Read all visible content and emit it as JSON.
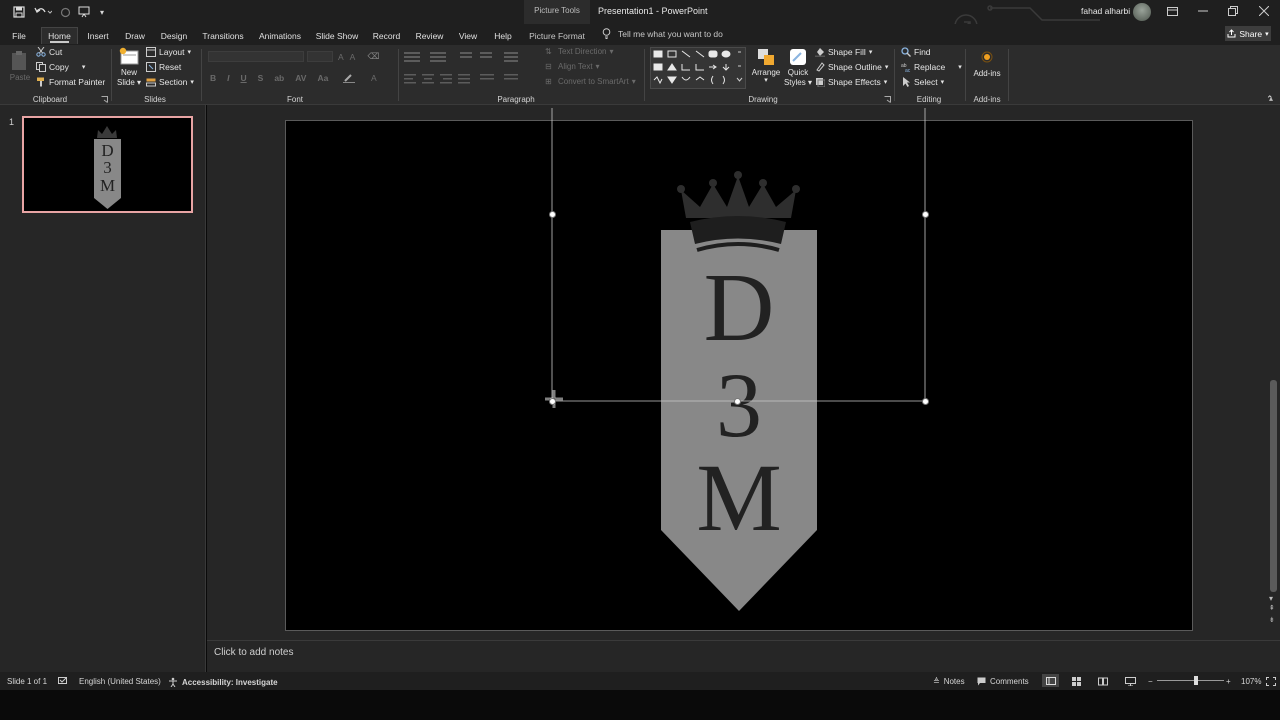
{
  "titlebar": {
    "tools_label": "Picture Tools",
    "doc_title": "Presentation1  -  PowerPoint",
    "user_name": "fahad alharbi"
  },
  "tabs": [
    {
      "label": "File"
    },
    {
      "label": "Home"
    },
    {
      "label": "Insert"
    },
    {
      "label": "Draw"
    },
    {
      "label": "Design"
    },
    {
      "label": "Transitions"
    },
    {
      "label": "Animations"
    },
    {
      "label": "Slide Show"
    },
    {
      "label": "Record"
    },
    {
      "label": "Review"
    },
    {
      "label": "View"
    },
    {
      "label": "Help"
    },
    {
      "label": "Picture Format"
    }
  ],
  "active_tab": "Home",
  "tell_me": "Tell me what you want to do",
  "share": "Share",
  "ribbon": {
    "clipboard": {
      "label": "Clipboard",
      "paste": "Paste",
      "cut": "Cut",
      "copy": "Copy",
      "format_painter": "Format Painter"
    },
    "slides": {
      "label": "Slides",
      "new_slide_1": "New",
      "new_slide_2": "Slide",
      "layout": "Layout",
      "reset": "Reset",
      "section": "Section"
    },
    "font": {
      "label": "Font"
    },
    "paragraph": {
      "label": "Paragraph",
      "text_direction": "Text Direction",
      "align_text": "Align Text",
      "convert_smartart": "Convert to SmartArt"
    },
    "drawing": {
      "label": "Drawing",
      "arrange": "Arrange",
      "quick_styles_1": "Quick",
      "quick_styles_2": "Styles",
      "shape_fill": "Shape Fill",
      "shape_outline": "Shape Outline",
      "shape_effects": "Shape Effects"
    },
    "editing": {
      "label": "Editing",
      "find": "Find",
      "replace": "Replace",
      "select": "Select"
    },
    "addins": {
      "label": "Add-ins",
      "button": "Add-ins"
    }
  },
  "slides_panel": {
    "slide_number": "1"
  },
  "slide": {
    "letters": [
      "D",
      "3",
      "M"
    ],
    "fill_color": "#888888",
    "text_color": "#222222",
    "background": "#000000"
  },
  "thumbnail": {
    "letters": [
      "D",
      "3",
      "M"
    ]
  },
  "notes": {
    "placeholder": "Click to add notes"
  },
  "status": {
    "slide_count": "Slide 1 of 1",
    "language": "English (United States)",
    "accessibility": "Accessibility: Investigate",
    "notes": "Notes",
    "comments": "Comments",
    "zoom": "107%",
    "zoom_level": 0.58
  },
  "colors": {
    "accent_border": "#e8a4a4",
    "addin_dot": "#f0a020"
  }
}
